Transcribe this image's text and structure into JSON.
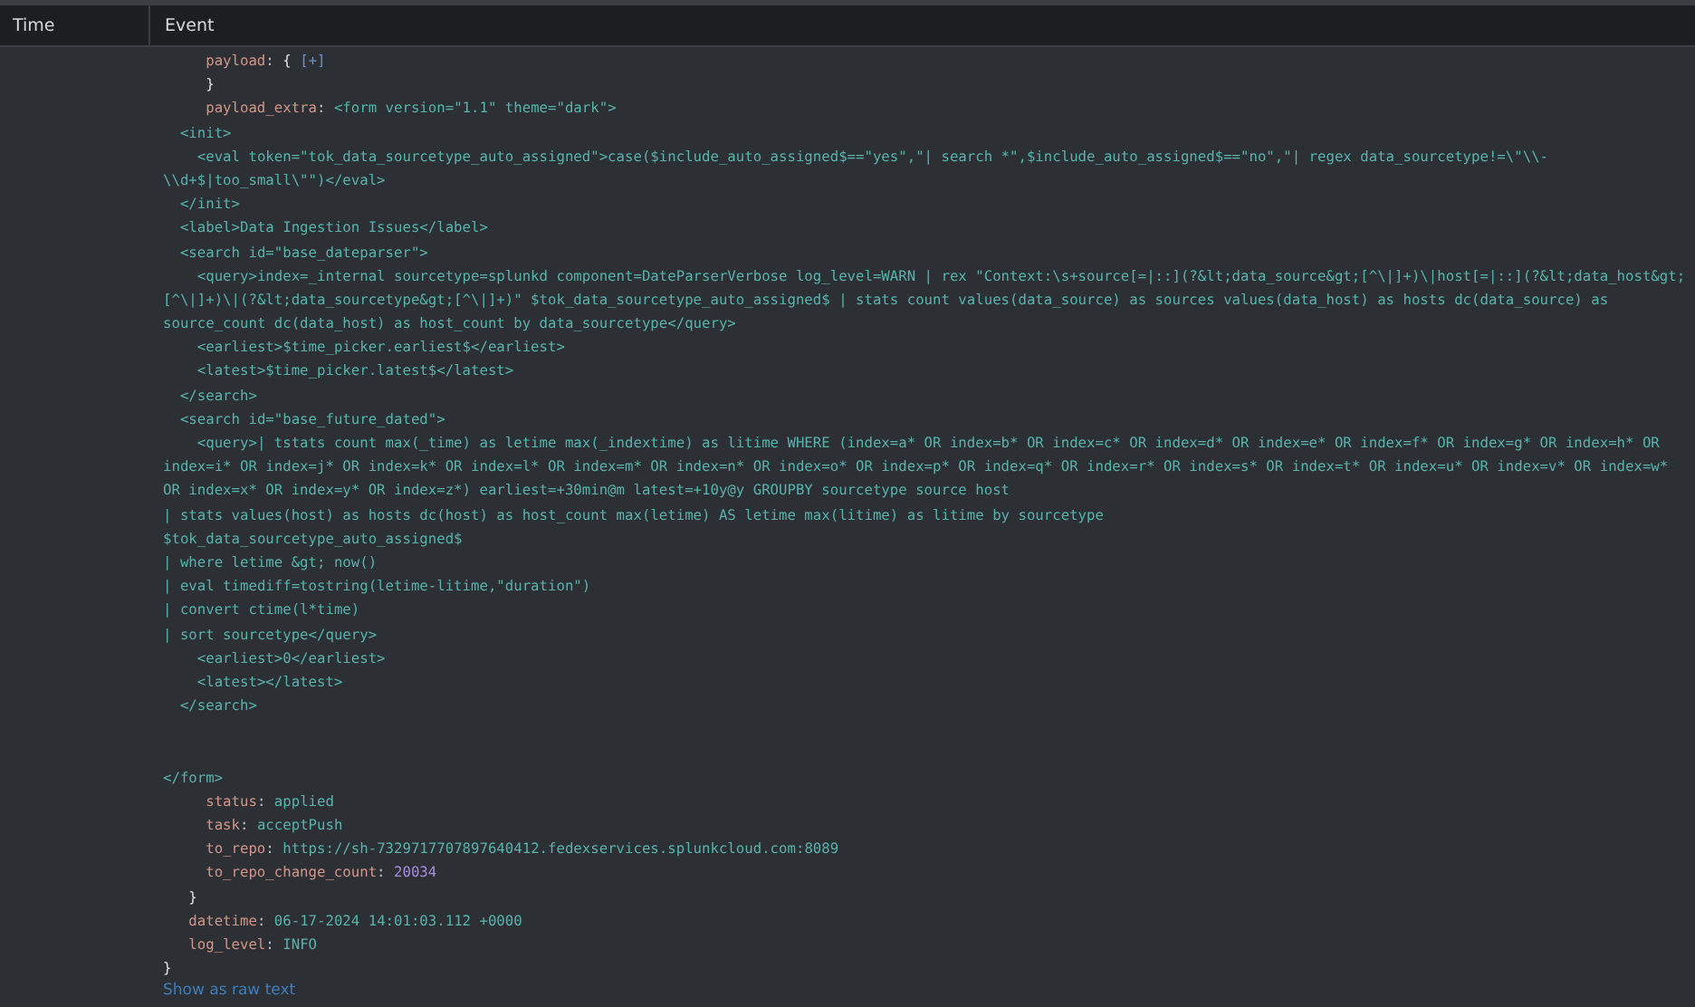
{
  "columns": [
    {
      "label": "Time"
    },
    {
      "label": "Event"
    }
  ],
  "event_lines": [
    {
      "kind": "group",
      "children": [
        {
          "kind": "group",
          "children": [
            {
              "kind": "collapsed",
              "key": "payload",
              "sep": ":",
              "brace": "{",
              "toggle": "[+]"
            },
            {
              "kind": "brace",
              "text": "}"
            },
            {
              "kind": "kv_text",
              "key": "payload_extra",
              "sep": ":",
              "value": "<form version=\"1.1\" theme=\"dark\">"
            }
          ]
        }
      ]
    },
    {
      "kind": "text",
      "text": "  <init>"
    },
    {
      "kind": "text",
      "text": "    <eval token=\"tok_data_sourcetype_auto_assigned\">case($include_auto_assigned$==\"yes\",\"| search *\",$include_auto_assigned$==\"no\",\"| regex data_sourcetype!=\\\"\\\\-"
    },
    {
      "kind": "text",
      "text": "\\\\d+$|too_small\\\"\")</eval>"
    },
    {
      "kind": "text",
      "text": "  </init>"
    },
    {
      "kind": "text",
      "text": "  <label>Data Ingestion Issues</label>"
    },
    {
      "kind": "text",
      "text": "  <search id=\"base_dateparser\">"
    },
    {
      "kind": "text",
      "text": "    <query>index=_internal sourcetype=splunkd component=DateParserVerbose log_level=WARN | rex \"Context:\\s+source[=|::](?&lt;data_source&gt;[^\\|]+)\\|host[=|::](?&lt;data_host&gt;"
    },
    {
      "kind": "text",
      "text": "[^\\|]+)\\|(?&lt;data_sourcetype&gt;[^\\|]+)\" $tok_data_sourcetype_auto_assigned$ | stats count values(data_source) as sources values(data_host) as hosts dc(data_source) as"
    },
    {
      "kind": "text",
      "text": "source_count dc(data_host) as host_count by data_sourcetype</query>"
    },
    {
      "kind": "text",
      "text": "    <earliest>$time_picker.earliest$</earliest>"
    },
    {
      "kind": "text",
      "text": "    <latest>$time_picker.latest$</latest>"
    },
    {
      "kind": "text",
      "text": "  </search>"
    },
    {
      "kind": "text",
      "text": "  <search id=\"base_future_dated\">"
    },
    {
      "kind": "text",
      "text": "    <query>| tstats count max(_time) as letime max(_indextime) as litime WHERE (index=a* OR index=b* OR index=c* OR index=d* OR index=e* OR index=f* OR index=g* OR index=h* OR"
    },
    {
      "kind": "text",
      "text": "index=i* OR index=j* OR index=k* OR index=l* OR index=m* OR index=n* OR index=o* OR index=p* OR index=q* OR index=r* OR index=s* OR index=t* OR index=u* OR index=v* OR index=w*"
    },
    {
      "kind": "text",
      "text": "OR index=x* OR index=y* OR index=z*) earliest=+30min@m latest=+10y@y GROUPBY sourcetype source host"
    },
    {
      "kind": "text",
      "text": "| stats values(host) as hosts dc(host) as host_count max(letime) AS letime max(litime) as litime by sourcetype"
    },
    {
      "kind": "text",
      "text": "$tok_data_sourcetype_auto_assigned$"
    },
    {
      "kind": "text",
      "text": "| where letime &gt; now()"
    },
    {
      "kind": "text",
      "text": "| eval timediff=tostring(letime-litime,\"duration\")"
    },
    {
      "kind": "text",
      "text": "| convert ctime(l*time)"
    },
    {
      "kind": "text",
      "text": "| sort sourcetype</query>"
    },
    {
      "kind": "text",
      "text": "    <earliest>0</earliest>"
    },
    {
      "kind": "text",
      "text": "    <latest></latest>"
    },
    {
      "kind": "text",
      "text": "  </search>"
    },
    {
      "kind": "blank"
    },
    {
      "kind": "blank"
    },
    {
      "kind": "text",
      "text": "</form>"
    },
    {
      "kind": "group",
      "children": [
        {
          "kind": "group",
          "children": [
            {
              "kind": "kv_text",
              "key": "status",
              "sep": ":",
              "value": "applied"
            },
            {
              "kind": "kv_text",
              "key": "task",
              "sep": ":",
              "value": "acceptPush"
            },
            {
              "kind": "kv_text",
              "key": "to_repo",
              "sep": ":",
              "value": "https://sh-7329717707897640412.fedexservices.splunkcloud.com:8089"
            },
            {
              "kind": "kv_number",
              "key": "to_repo_change_count",
              "sep": ":",
              "value": "20034"
            }
          ]
        },
        {
          "kind": "brace",
          "text": "}"
        },
        {
          "kind": "kv_text",
          "key": "datetime",
          "sep": ":",
          "value": "06-17-2024 14:01:03.112 +0000"
        },
        {
          "kind": "kv_text",
          "key": "log_level",
          "sep": ":",
          "value": "INFO"
        }
      ]
    },
    {
      "kind": "brace",
      "text": "}"
    }
  ],
  "raw_link": "Show as raw text"
}
